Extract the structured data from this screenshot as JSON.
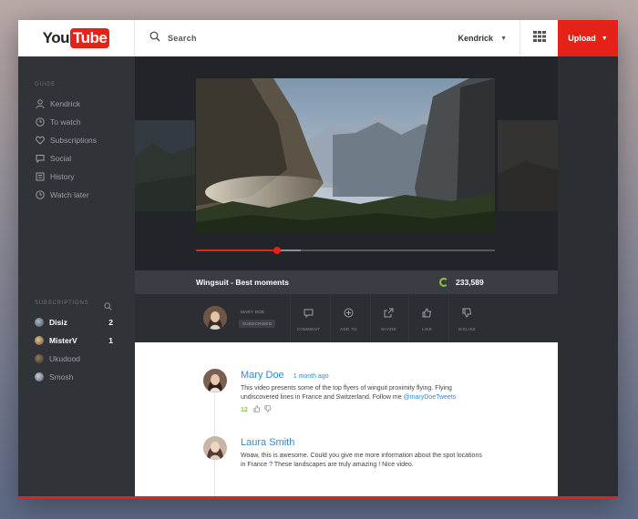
{
  "header": {
    "logo_you": "You",
    "logo_tube": "Tube",
    "search_placeholder": "Search",
    "user_name": "Kendrick",
    "upload_label": "Upload"
  },
  "sidebar": {
    "guide_title": "GUIDE",
    "guide_items": [
      {
        "label": "Kendrick",
        "icon": "user-icon"
      },
      {
        "label": "To watch",
        "icon": "clock-icon"
      },
      {
        "label": "Subscriptions",
        "icon": "heart-icon"
      },
      {
        "label": "Social",
        "icon": "chat-icon"
      },
      {
        "label": "History",
        "icon": "history-icon"
      },
      {
        "label": "Watch later",
        "icon": "clock-icon"
      }
    ],
    "subscriptions_title": "SUBSCRIPTIONS",
    "subscriptions": [
      {
        "label": "Disiz",
        "count": "2",
        "bold": true
      },
      {
        "label": "MisterV",
        "count": "1",
        "bold": true
      },
      {
        "label": "Ukudood",
        "count": "",
        "bold": false
      },
      {
        "label": "Smosh",
        "count": "",
        "bold": false
      }
    ]
  },
  "player": {
    "progress_fraction": 0.27,
    "buffered_fraction": 0.35
  },
  "video": {
    "title": "Wingsuit - Best moments",
    "views": "233,589"
  },
  "channel": {
    "name": "MARY DOE",
    "subscribed_label": "SUBSCRIBED"
  },
  "actions": [
    {
      "label": "COMMENT",
      "icon": "comment-icon"
    },
    {
      "label": "ADD TO",
      "icon": "add-icon"
    },
    {
      "label": "SHARE",
      "icon": "share-icon"
    },
    {
      "label": "LIKE",
      "icon": "thumbs-up-icon"
    },
    {
      "label": "DISLIKE",
      "icon": "thumbs-down-icon"
    }
  ],
  "comments": [
    {
      "author": "Mary Doe",
      "time": "1 month ago",
      "text": "This video presents some of the top flyers of winguit proximity flying. Flying undiscovered lines in France and Switzerland. Follow me ",
      "mention": "@maryDoeTweets",
      "likes": "12"
    },
    {
      "author": "Laura Smith",
      "time": "",
      "text": "Woaw, this is awesome. Could you give me more information about the spot locations in France ? These landscapes are truly amazing ! Nice video.",
      "mention": "",
      "likes": ""
    }
  ],
  "colors": {
    "accent": "#e62117",
    "link": "#2f8ad8",
    "positive": "#8fc73e"
  }
}
